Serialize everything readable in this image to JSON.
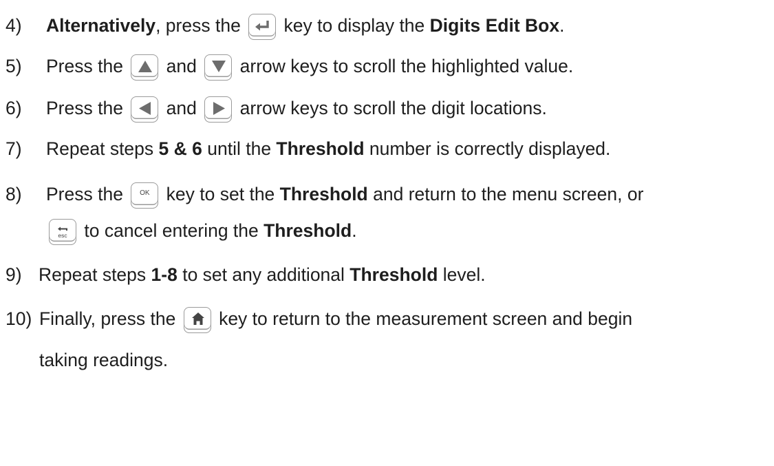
{
  "steps": [
    {
      "num": "4)",
      "parts": [
        {
          "b": "Alternatively"
        },
        {
          "t": ", press the "
        },
        {
          "key": "enter-key-icon"
        },
        {
          "t": " key to display the "
        },
        {
          "b": "Digits Edit Box"
        },
        {
          "t": "."
        }
      ]
    },
    {
      "num": "5)",
      "parts": [
        {
          "t": "Press the "
        },
        {
          "key": "up-arrow-key-icon"
        },
        {
          "t": " and "
        },
        {
          "key": "down-arrow-key-icon"
        },
        {
          "t": " arrow keys to scroll the highlighted value."
        }
      ]
    },
    {
      "num": "6)",
      "parts": [
        {
          "t": "Press the "
        },
        {
          "key": "left-arrow-key-icon"
        },
        {
          "t": " and "
        },
        {
          "key": "right-arrow-key-icon"
        },
        {
          "t": " arrow keys to scroll the digit locations."
        }
      ]
    },
    {
      "num": "7)",
      "parts": [
        {
          "t": "Repeat steps "
        },
        {
          "b": "5 & 6"
        },
        {
          "t": " until the "
        },
        {
          "b": "Threshold"
        },
        {
          "t": " number is correctly displayed."
        }
      ]
    },
    {
      "num": "8)",
      "parts": [
        {
          "t": "Press the "
        },
        {
          "key": "ok-key-icon"
        },
        {
          "t": " key to set the "
        },
        {
          "b": "Threshold"
        },
        {
          "t": " and return to the menu screen, or"
        }
      ]
    },
    {
      "num": "",
      "parts": [
        {
          "key": "esc-key-icon"
        },
        {
          "t": " to cancel entering the "
        },
        {
          "b": "Threshold"
        },
        {
          "t": "."
        }
      ]
    },
    {
      "num": "9)",
      "parts": [
        {
          "t": "Repeat steps "
        },
        {
          "b": "1-8"
        },
        {
          "t": " to set any additional "
        },
        {
          "b": "Threshold"
        },
        {
          "t": " level."
        }
      ]
    },
    {
      "num": "10)",
      "parts": [
        {
          "t": "Finally, press the "
        },
        {
          "key": "home-key-icon"
        },
        {
          "t": " key to return to the measurement screen and begin"
        }
      ]
    },
    {
      "num": "",
      "parts": [
        {
          "t": "taking readings."
        }
      ]
    }
  ],
  "key_labels": {
    "ok": "OK",
    "esc": "esc"
  }
}
